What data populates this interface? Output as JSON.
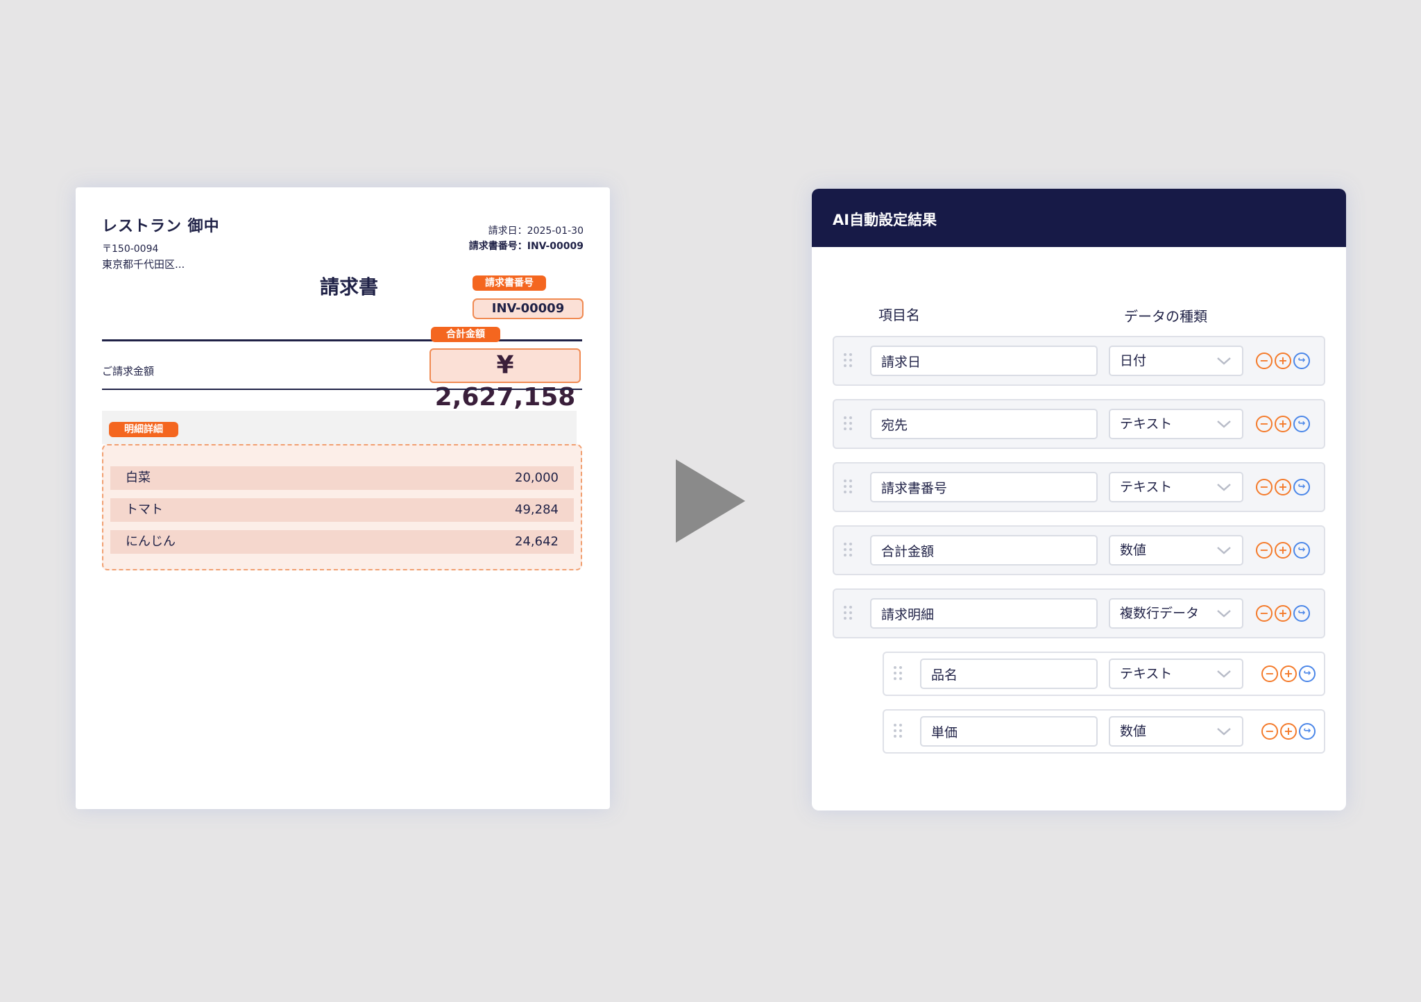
{
  "invoice": {
    "client": "レストラン 御中",
    "postal": "〒150-0094",
    "address": "東京都千代田区...",
    "date_line": "請求日：2025-01-30",
    "number_line": "請求書番号：INV-00009",
    "title": "請求書",
    "tag_number": "請求書番号",
    "number_value": "INV-00009",
    "tag_total": "合計金額",
    "amount_label": "ご請求金額",
    "amount_value": "¥ 2,627,158",
    "tag_details": "明細詳細",
    "items": [
      {
        "name": "白菜",
        "value": "20,000"
      },
      {
        "name": "トマト",
        "value": "49,284"
      },
      {
        "name": "にんじん",
        "value": "24,642"
      }
    ]
  },
  "panel": {
    "title": "AI自動設定結果",
    "col_name": "項目名",
    "col_type": "データの種類",
    "rows": [
      {
        "name": "請求日",
        "type": "日付"
      },
      {
        "name": "宛先",
        "type": "テキスト"
      },
      {
        "name": "請求書番号",
        "type": "テキスト"
      },
      {
        "name": "合計金額",
        "type": "数値"
      },
      {
        "name": "請求明細",
        "type": "複数行データ"
      },
      {
        "name": "品名",
        "type": "テキスト"
      },
      {
        "name": "単価",
        "type": "数値"
      }
    ],
    "button_glyphs": {
      "remove": "−",
      "add": "+",
      "sub": "↪"
    },
    "colors": {
      "header": "#171a47",
      "accent": "#f4661f",
      "link": "#4a86e8"
    }
  }
}
